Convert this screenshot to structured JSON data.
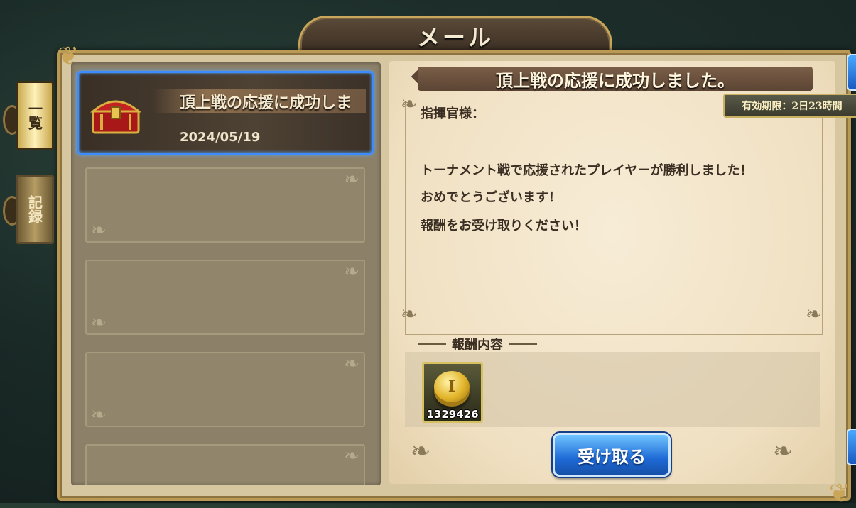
{
  "window_title": "メール",
  "side_tabs": [
    {
      "label": "一覧",
      "active": true
    },
    {
      "label": "記録",
      "active": false
    }
  ],
  "mail_list": [
    {
      "title": "頂上戦の応援に成功しま",
      "date": "2024/05/19",
      "icon": "treasure-chest-icon",
      "selected": true
    }
  ],
  "message": {
    "title": "頂上戦の応援に成功しました。",
    "expiry": "有効期限：2日23時間",
    "salutation": "指揮官様：",
    "body": [
      "トーナメント戦で応援されたプレイヤーが勝利しました！",
      "おめでとうございます！",
      "報酬をお受け取りください！"
    ],
    "reward_header": "報酬内容",
    "rewards": [
      {
        "icon": "gold-coin-icon",
        "quantity": "1329426"
      }
    ],
    "receive_button": "受け取る"
  },
  "colors": {
    "selection_border": "#3c8cff",
    "frame_gold": "#b99953",
    "button_blue": "#1e6ad6"
  }
}
